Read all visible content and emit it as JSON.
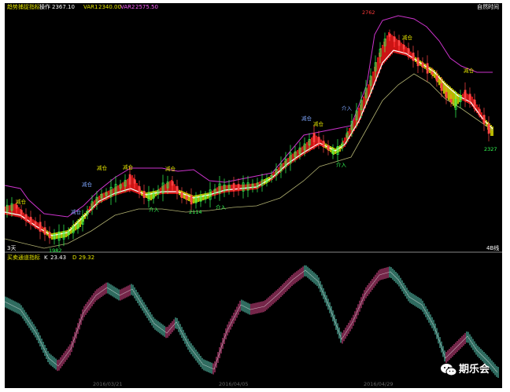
{
  "upper_panel": {
    "indicator_name": "趋势捕捉指标",
    "op_label": "操作",
    "op_value": "2367.10",
    "var1_label": "VAR1",
    "var1_value": "2340.00",
    "var2_label": "VAR2",
    "var2_value": "2575.50",
    "right_label": "自然时间",
    "left_footer": "3天",
    "right_footer": "4B线"
  },
  "lower_panel": {
    "indicator_name": "买卖通道指标",
    "k_label": "K",
    "k_value": "23.43",
    "d_label": "D",
    "d_value": "29.32"
  },
  "date_axis": [
    "2016/03/21",
    "2016/04/05",
    "2016/04/29"
  ],
  "signals": [
    {
      "kind": "reduce",
      "text": "减仓"
    },
    {
      "kind": "reduce",
      "text": "减仓"
    },
    {
      "kind": "reduce",
      "text": "减仓"
    },
    {
      "kind": "reduce",
      "text": "减仓"
    },
    {
      "kind": "reduce",
      "text": "减仓"
    },
    {
      "kind": "reduce",
      "text": "减仓"
    },
    {
      "kind": "reduce",
      "text": "减仓"
    },
    {
      "kind": "reduce",
      "text": "减仓"
    },
    {
      "kind": "reduce",
      "text": "减仓"
    },
    {
      "kind": "reduce",
      "text": "减仓"
    },
    {
      "kind": "buy",
      "text": "介入"
    },
    {
      "kind": "buy",
      "text": "介入"
    },
    {
      "kind": "buy",
      "text": "介入"
    },
    {
      "kind": "buy",
      "text": "介入"
    }
  ],
  "price_marks": [
    {
      "text": "1982",
      "color": "#33ff55"
    },
    {
      "text": "2114",
      "color": "#33ff55"
    },
    {
      "text": "2762",
      "color": "#ff3a3a"
    },
    {
      "text": "2327",
      "color": "#33ff55"
    }
  ],
  "watermark": {
    "text": "期乐会",
    "icon": "wechat-icon"
  },
  "colors": {
    "background": "#000000",
    "up_band": "#ff1a1a",
    "down_band": "#e6e600",
    "resistance": "#cc33cc",
    "support": "#b0b070",
    "k_up": "#c0407a",
    "k_down": "#4fb3a0"
  }
}
